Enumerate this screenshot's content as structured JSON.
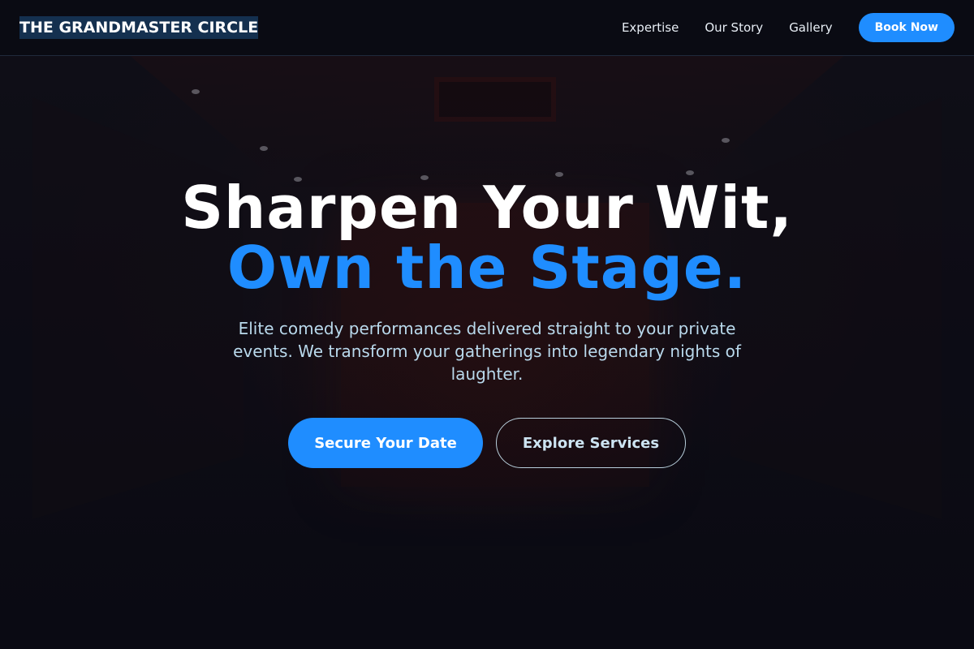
{
  "header": {
    "logo_text": "THE GRANDMASTER CIRCLE",
    "nav_links": [
      "Expertise",
      "Our Story",
      "Gallery"
    ],
    "book_button": "Book Now"
  },
  "hero": {
    "headline_line1": "Sharpen Your Wit,",
    "headline_line2": "Own the Stage.",
    "subtitle": "Elite comedy performances delivered straight to your private events. We transform your gatherings into legendary nights of laughter.",
    "primary_cta": "Secure Your Date",
    "secondary_cta": "Explore Services"
  },
  "colors": {
    "accent": "#1f8dff",
    "background": "#0b0c14",
    "subtitle_text": "#b9d9ec",
    "logo_highlight": "#14304f"
  },
  "background_image": "dark comedy-club-stage-icon"
}
